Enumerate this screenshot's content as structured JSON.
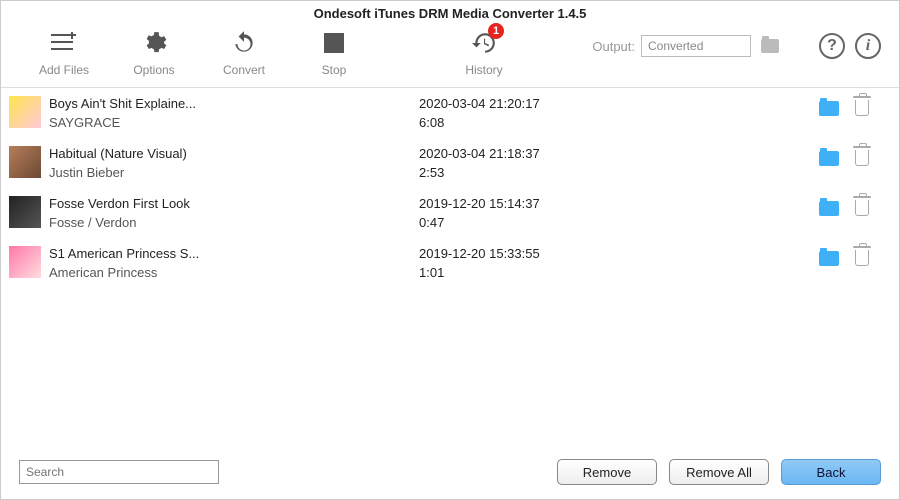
{
  "title": "Ondesoft iTunes DRM Media Converter 1.4.5",
  "toolbar": {
    "add_files": "Add Files",
    "options": "Options",
    "convert": "Convert",
    "stop": "Stop",
    "history": "History",
    "history_badge": "1",
    "output_label": "Output:",
    "output_value": "Converted"
  },
  "items": [
    {
      "title": "Boys Ain't Shit Explaine...",
      "subtitle": "SAYGRACE",
      "timestamp": "2020-03-04 21:20:17",
      "duration": "6:08"
    },
    {
      "title": "Habitual (Nature Visual)",
      "subtitle": "Justin Bieber",
      "timestamp": "2020-03-04 21:18:37",
      "duration": "2:53"
    },
    {
      "title": "Fosse Verdon  First Look",
      "subtitle": "Fosse / Verdon",
      "timestamp": "2019-12-20 15:14:37",
      "duration": "0:47"
    },
    {
      "title": "S1 American Princess S...",
      "subtitle": "American Princess",
      "timestamp": "2019-12-20 15:33:55",
      "duration": "1:01"
    }
  ],
  "footer": {
    "search_placeholder": "Search",
    "remove": "Remove",
    "remove_all": "Remove All",
    "back": "Back"
  }
}
